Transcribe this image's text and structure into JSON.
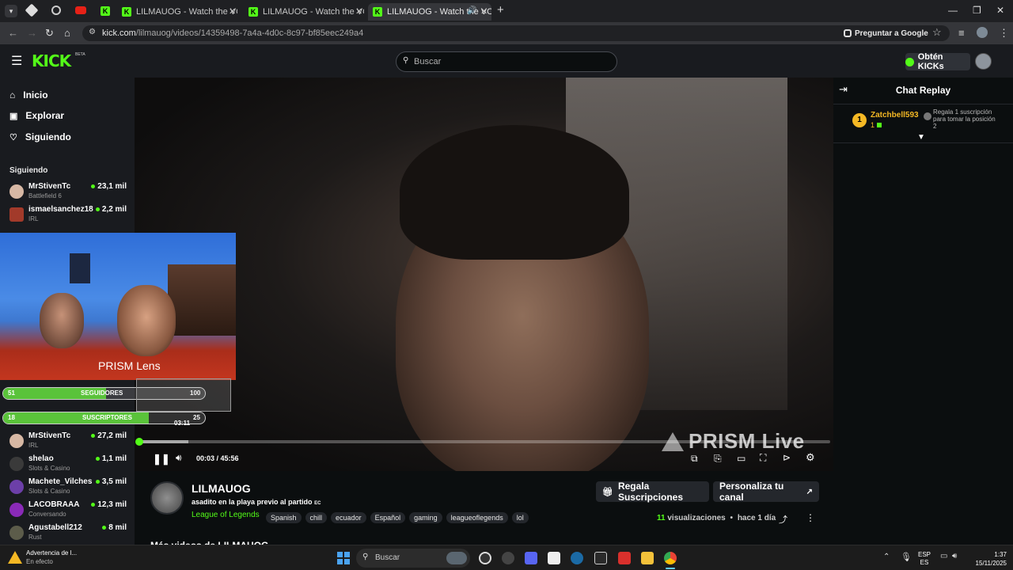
{
  "browser": {
    "tabs": [
      {
        "title": "LILMAUOG - Watch the VOD o"
      },
      {
        "title": "LILMAUOG - Watch the VOD o"
      },
      {
        "title": "LILMAUOG - Watch the VOD"
      }
    ],
    "url_domain": "kick.com",
    "url_path": "/lilmauog/videos/14359498-7a4a-4d0c-8c97-bf85eec249a4",
    "google_button": "Preguntar a Google"
  },
  "header": {
    "logo": "KICK",
    "logo_badge": "BETA",
    "search_placeholder": "Buscar",
    "kicks_button": "Obtén KICKs"
  },
  "sidebar": {
    "nav": [
      {
        "label": "Inicio"
      },
      {
        "label": "Explorar"
      },
      {
        "label": "Siguiendo"
      }
    ],
    "section_title": "Siguiendo",
    "channels_top": [
      {
        "name": "MrStivenTc",
        "category": "Battlefield 6",
        "viewers": "23,1 mil"
      },
      {
        "name": "ismaelsanchez18",
        "category": "IRL",
        "viewers": "2,2 mil"
      }
    ],
    "channels_bottom": [
      {
        "name": "MrStivenTc",
        "category": "IRL",
        "viewers": "27,2 mil"
      },
      {
        "name": "shelao",
        "category": "Slots & Casino",
        "viewers": "1,1 mil"
      },
      {
        "name": "Machete_Vilches",
        "category": "Slots & Casino",
        "viewers": "3,5 mil"
      },
      {
        "name": "LACOBRAAA",
        "category": "Conversando",
        "viewers": "12,3 mil"
      },
      {
        "name": "Agustabell212",
        "category": "Rust",
        "viewers": "8 mil"
      }
    ]
  },
  "overlay": {
    "brand": "PRISM Lens",
    "followers_label": "SEGUIDORES",
    "followers_current": "51",
    "followers_goal": "100",
    "followers_progress": 0.51,
    "subs_label": "SUSCRIPTORES",
    "subs_current": "18",
    "subs_goal": "25",
    "subs_progress": 0.72,
    "timer": "03:11"
  },
  "player": {
    "watermark": "PRISM Live",
    "time_current": "00:03",
    "time_total": "45:56",
    "progress": 0.001
  },
  "chat": {
    "title": "Chat Replay",
    "message": {
      "rank": "1",
      "user": "Zatchbell593",
      "badge_count": "1",
      "text": "Regala 1 suscripción para tomar la posición 2"
    }
  },
  "stream_info": {
    "channel": "LILMAUOG",
    "title": "asadito en la playa previo al partido",
    "title_suffix": "EC",
    "category": "League of Legends",
    "tags": [
      "Spanish",
      "chill",
      "ecuador",
      "Español",
      "gaming",
      "leagueoflegends",
      "lol"
    ],
    "gift_button": "Regala Suscripciones",
    "customize_button": "Personaliza tu canal",
    "views_count": "11",
    "views_label": "visualizaciones",
    "time_ago": "hace 1 día",
    "more_videos": "Más videos de LILMAUOG"
  },
  "taskbar": {
    "notification_title": "Advertencia de l...",
    "notification_sub": "En efecto",
    "search": "Buscar",
    "lang_top": "ESP",
    "lang_bottom": "ES",
    "time": "1:37",
    "date": "15/11/2025"
  },
  "colors": {
    "kick_green": "#53fc18",
    "gold": "#f5b824"
  }
}
